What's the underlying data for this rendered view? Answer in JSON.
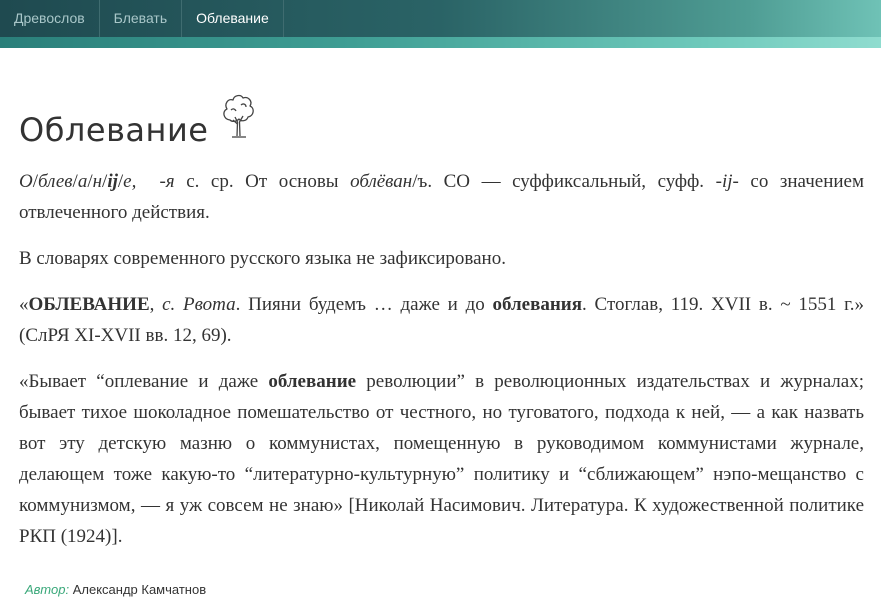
{
  "nav": {
    "tabs": [
      {
        "label": "Древослов"
      },
      {
        "label": "Блевать"
      },
      {
        "label": "Облевание"
      }
    ]
  },
  "article": {
    "title": "Облевание",
    "morph": {
      "segments": [
        "О",
        "/",
        "блев",
        "/",
        "а",
        "/",
        "н",
        "/",
        "ij",
        "/",
        "е,"
      ],
      "ending": "-я",
      "text1": " с. ср. От основы ",
      "stem": "облёван",
      "text2": "/ъ. СО — суффиксальный, суфф. ",
      "suffix": "-ij-",
      "text3": " со значением отвлеченного действия."
    },
    "note": "В словарях современного русского языка не зафиксировано.",
    "quote1": {
      "open": "«",
      "headword": "ОБЛЕВАНИЕ",
      "comma": ", ",
      "gloss": "с. Рвота",
      "text1": ". Пияни будемъ … даже и до ",
      "bold": "облевания",
      "text2": ". Стоглав, 119. XVII в. ~ 1551 г.» (СлРЯ XI-XVII вв. 12, 69)."
    },
    "quote2": {
      "text1": "«Бывает “оплевание и даже ",
      "bold": "облевание",
      "text2": " революции” в революционных издательствах и журналах; бывает тихое шоколадное помешательство от честного, но туговатого, подхода к ней, — а как назвать вот эту детскую мазню о коммунистах, помещенную в руководимом коммунистами журнале, делающем тоже какую-то “литературно-культурную” политику и “сближающем” нэпо-мещанство с коммунизмом, — я уж совсем не знаю» [Николай Насимович. Литература. К художественной политике РКП (1924)]."
    },
    "author_label": "Автор",
    "author_sep": ":",
    "author_name": "Александр Камчатнов"
  },
  "icons": {
    "title_icon": "tree-icon"
  }
}
